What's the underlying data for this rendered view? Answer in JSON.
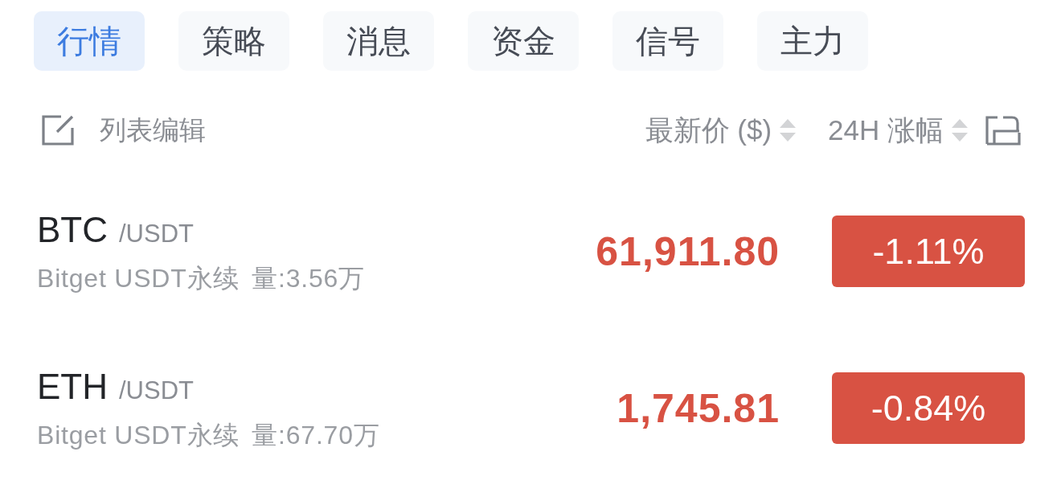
{
  "tabs": [
    {
      "label": "行情",
      "selected": true
    },
    {
      "label": "策略",
      "selected": false
    },
    {
      "label": "消息",
      "selected": false
    },
    {
      "label": "资金",
      "selected": false
    },
    {
      "label": "信号",
      "selected": false
    },
    {
      "label": "主力",
      "selected": false
    }
  ],
  "list_header": {
    "edit_label": "列表编辑",
    "columns": [
      {
        "label": "最新价 ($)"
      },
      {
        "label": "24H 涨幅"
      }
    ]
  },
  "rows": [
    {
      "symbol": "BTC",
      "quote": "/USDT",
      "exchange": "Bitget USDT永续",
      "volume": "量:3.56万",
      "price": "61,911.80",
      "change": "-1.11%",
      "falling": true
    },
    {
      "symbol": "ETH",
      "quote": "/USDT",
      "exchange": "Bitget USDT永续",
      "volume": "量:67.70万",
      "price": "1,745.81",
      "change": "-0.84%",
      "falling": true
    }
  ]
}
